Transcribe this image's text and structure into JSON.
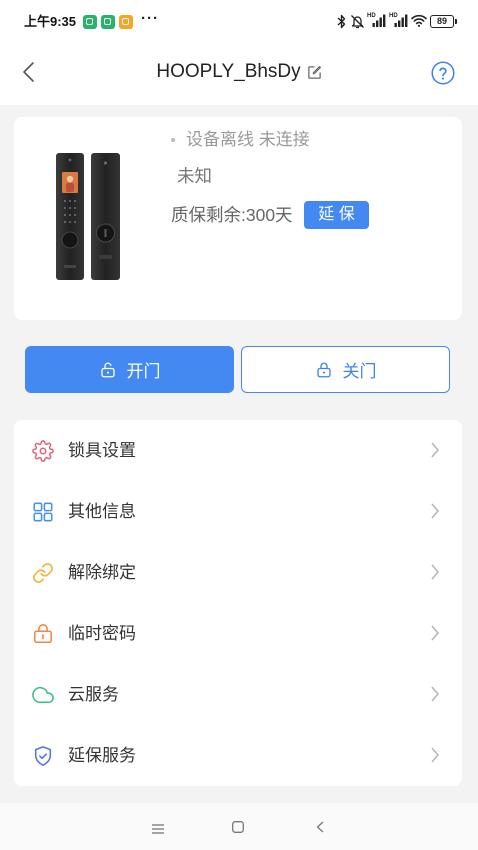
{
  "status_bar": {
    "time": "上午9:35",
    "more": "···",
    "network_1": "HD",
    "network_2": "HD",
    "battery": "89",
    "app_icons": [
      {
        "icon": "app-notification-icon",
        "color": "#27b36a"
      },
      {
        "icon": "app-notification-icon",
        "color": "#27b36a"
      },
      {
        "icon": "app-notification-icon",
        "color": "#f5a623"
      }
    ],
    "system_icons": [
      "bluetooth-icon",
      "mute-icon",
      "signal-icon",
      "signal-icon",
      "wifi-icon",
      "battery-icon"
    ]
  },
  "header": {
    "title": "HOOPLY_BhsDy",
    "back_icon": "chevron-left-icon",
    "edit_icon": "edit-icon",
    "help_icon": "help-icon"
  },
  "device": {
    "status": "设备离线 未连接",
    "info": "未知",
    "warranty": "质保剩余:300天",
    "extend_label": "延 保"
  },
  "actions": {
    "open_label": "开门",
    "open_icon": "unlock-icon",
    "close_label": "关门",
    "close_icon": "lock-icon"
  },
  "menu": {
    "items": [
      {
        "label": "锁具设置",
        "icon": "gear-icon",
        "color": "#e4667a"
      },
      {
        "label": "其他信息",
        "icon": "grid-icon",
        "color": "#4a8ef0"
      },
      {
        "label": "解除绑定",
        "icon": "link-icon",
        "color": "#f1b43a"
      },
      {
        "label": "临时密码",
        "icon": "lock-icon",
        "color": "#ee8848"
      },
      {
        "label": "云服务",
        "icon": "cloud-icon",
        "color": "#3dbd8c"
      },
      {
        "label": "延保服务",
        "icon": "shield-icon",
        "color": "#5b70e3"
      }
    ]
  },
  "nav": {
    "icons": [
      "menu-icon",
      "home-icon",
      "back-icon"
    ]
  },
  "colors": {
    "primary": "#4389f1",
    "primary_text": "#3f84ee",
    "background": "#f3f3f3",
    "card": "#ffffff",
    "text": "#333333",
    "muted": "#9a9a9a",
    "help": "#3d7ff0"
  }
}
